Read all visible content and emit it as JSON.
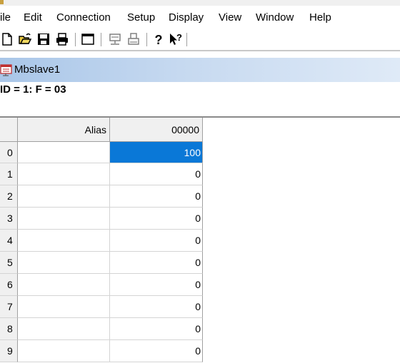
{
  "menu": [
    "ile",
    "Edit",
    "Connection",
    "Setup",
    "Display",
    "View",
    "Window",
    "Help"
  ],
  "toolbar": {
    "icons": [
      "new-icon",
      "open-icon",
      "save-icon",
      "print-icon",
      "window-icon",
      "connect-icon",
      "printer-setup-icon",
      "help-icon",
      "context-help-icon"
    ]
  },
  "window": {
    "title": "Mbslave1"
  },
  "status": {
    "text": "ID = 1: F = 03"
  },
  "table": {
    "columns": [
      "Alias",
      "00000"
    ],
    "rows": [
      {
        "index": "0",
        "alias": "",
        "value": "100",
        "selected": true
      },
      {
        "index": "1",
        "alias": "",
        "value": "0"
      },
      {
        "index": "2",
        "alias": "",
        "value": "0"
      },
      {
        "index": "3",
        "alias": "",
        "value": "0"
      },
      {
        "index": "4",
        "alias": "",
        "value": "0"
      },
      {
        "index": "5",
        "alias": "",
        "value": "0"
      },
      {
        "index": "6",
        "alias": "",
        "value": "0"
      },
      {
        "index": "7",
        "alias": "",
        "value": "0"
      },
      {
        "index": "8",
        "alias": "",
        "value": "0"
      },
      {
        "index": "9",
        "alias": "",
        "value": "0"
      }
    ]
  },
  "colors": {
    "selection": "#0a78d7",
    "title_gradient_start": "#a9c6e8"
  }
}
